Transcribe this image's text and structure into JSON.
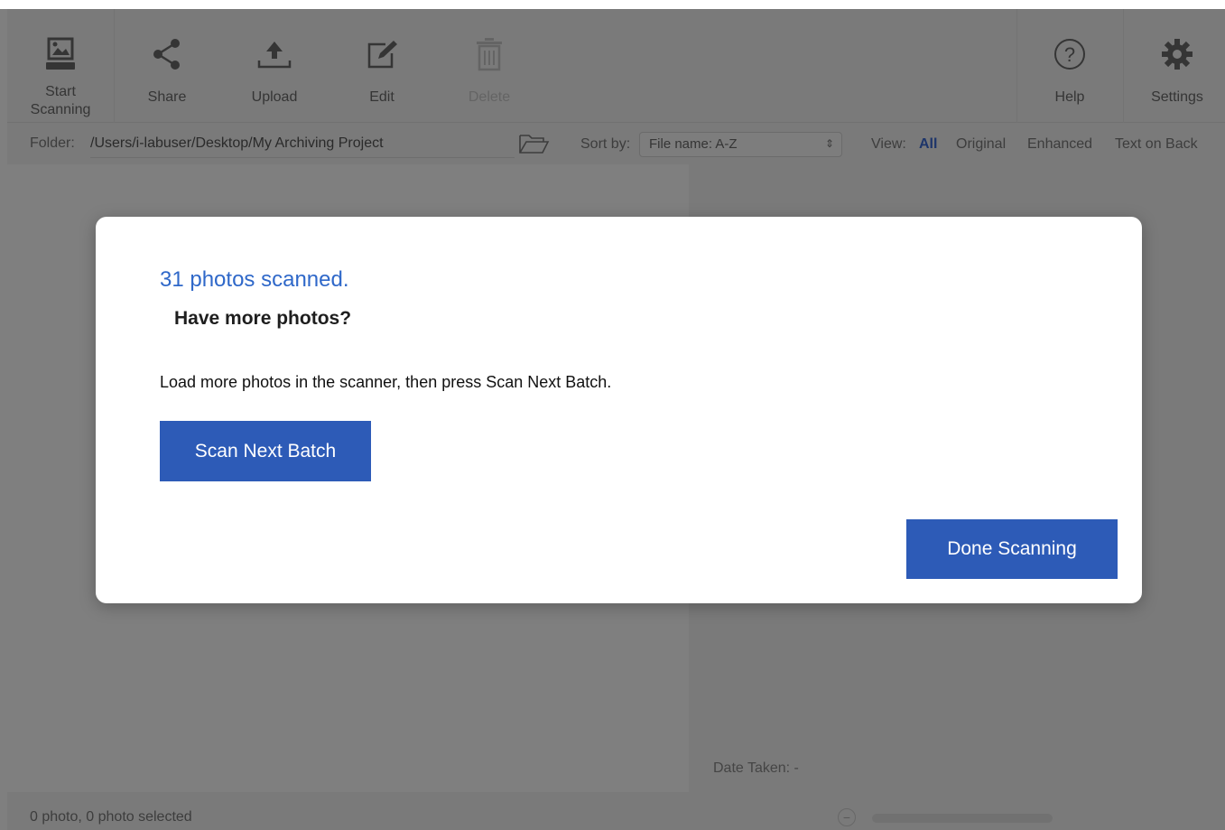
{
  "toolbar": {
    "start_label": "Start Scanning",
    "share_label": "Share",
    "upload_label": "Upload",
    "edit_label": "Edit",
    "delete_label": "Delete",
    "help_label": "Help",
    "settings_label": "Settings"
  },
  "filter": {
    "folder_label": "Folder:",
    "folder_path": "/Users/i-labuser/Desktop/My Archiving Project",
    "sort_label": "Sort by:",
    "sort_value": "File name: A-Z",
    "view_label": "View:",
    "view_options": [
      "All",
      "Original",
      "Enhanced",
      "Text on Back"
    ]
  },
  "details": {
    "date_taken": "Date Taken: -"
  },
  "status": {
    "text": "0 photo, 0 photo selected"
  },
  "dialog": {
    "count_text": "31 photos scanned.",
    "question": "Have more photos?",
    "instruction": "Load more photos in the scanner, then press Scan Next Batch.",
    "scan_next_label": "Scan Next Batch",
    "done_label": "Done Scanning"
  },
  "colors": {
    "accent": "#2f68c9",
    "button": "#2d5bb7",
    "overlay": "rgba(0,0,0,0.5)"
  },
  "icons": [
    "scanner-icon",
    "share-icon",
    "upload-icon",
    "edit-icon",
    "trash-icon",
    "help-icon",
    "gear-icon",
    "folder-icon"
  ]
}
